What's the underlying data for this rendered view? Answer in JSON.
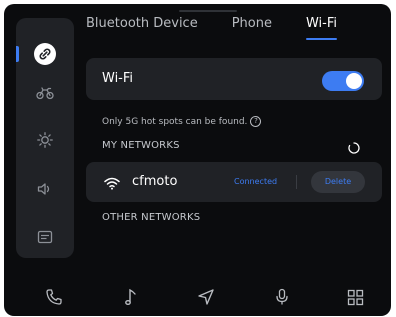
{
  "tabs": [
    {
      "label": "Bluetooth Device",
      "active": false
    },
    {
      "label": "Phone",
      "active": false
    },
    {
      "label": "Wi-Fi",
      "active": true
    }
  ],
  "sidebar": {
    "items": [
      {
        "icon": "link-icon",
        "active": true
      },
      {
        "icon": "motorcycle-icon",
        "active": false
      },
      {
        "icon": "brightness-icon",
        "active": false
      },
      {
        "icon": "volume-icon",
        "active": false
      },
      {
        "icon": "settings-card-icon",
        "active": false
      }
    ]
  },
  "wifi": {
    "label": "Wi-Fi",
    "enabled": true,
    "hint": "Only 5G hot spots can be found."
  },
  "my_networks": {
    "title": "MY NETWORKS",
    "items": [
      {
        "name": "cfmoto",
        "status": "Connected",
        "action": "Delete",
        "icon": "wifi-icon"
      }
    ]
  },
  "other_networks": {
    "title": "OTHER NETWORKS"
  },
  "dock": {
    "items": [
      {
        "icon": "phone-icon"
      },
      {
        "icon": "music-icon"
      },
      {
        "icon": "navigation-icon"
      },
      {
        "icon": "microphone-icon"
      },
      {
        "icon": "apps-grid-icon"
      }
    ]
  },
  "colors": {
    "accent": "#3d7cf2",
    "background": "#0b0c0e",
    "card": "#202226"
  }
}
